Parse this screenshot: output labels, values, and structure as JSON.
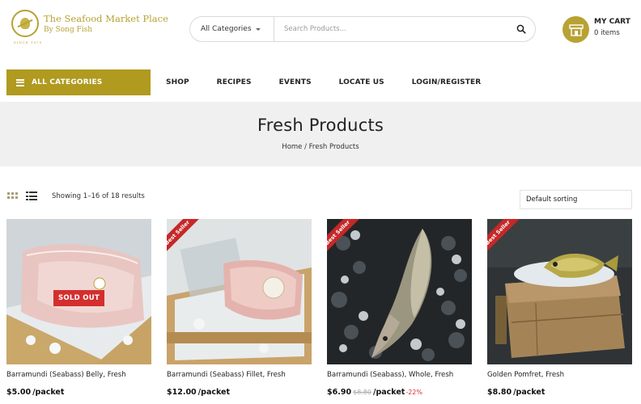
{
  "logo": {
    "title": "The Seafood Market Place",
    "subtitle": "By Song Fish",
    "since": "SINCE 1970"
  },
  "search": {
    "category": "All Categories",
    "placeholder": "Search Products..."
  },
  "cart": {
    "title": "MY CART",
    "count": "0 items"
  },
  "nav": {
    "all_categories": "ALL CATEGORIES",
    "items": [
      "SHOP",
      "RECIPES",
      "EVENTS",
      "LOCATE US",
      "LOGIN/REGISTER"
    ]
  },
  "page": {
    "title": "Fresh Products",
    "breadcrumb": "Home / Fresh Products"
  },
  "toolbar": {
    "results": "Showing 1–16 of 18 results",
    "sorting": "Default sorting"
  },
  "products": [
    {
      "name": "Barramundi (Seabass) Belly, Fresh",
      "price": "$5.00",
      "unit": "/packet",
      "badge": "SOLD OUT"
    },
    {
      "name": "Barramundi (Seabass) Fillet, Fresh",
      "price": "$12.00",
      "unit": "/packet",
      "ribbon": "Best Seller"
    },
    {
      "name": "Barramundi (Seabass), Whole, Fresh",
      "price": "$6.90",
      "old_price": "$8.80",
      "unit": "/packet",
      "discount": "-22%",
      "ribbon": "Best Seller"
    },
    {
      "name": "Golden Pomfret, Fresh",
      "price": "$8.80",
      "unit": "/packet",
      "ribbon": "Best Seller"
    }
  ],
  "colors": {
    "gold": "#b09a1f",
    "ribbon_red": "#c62828"
  }
}
